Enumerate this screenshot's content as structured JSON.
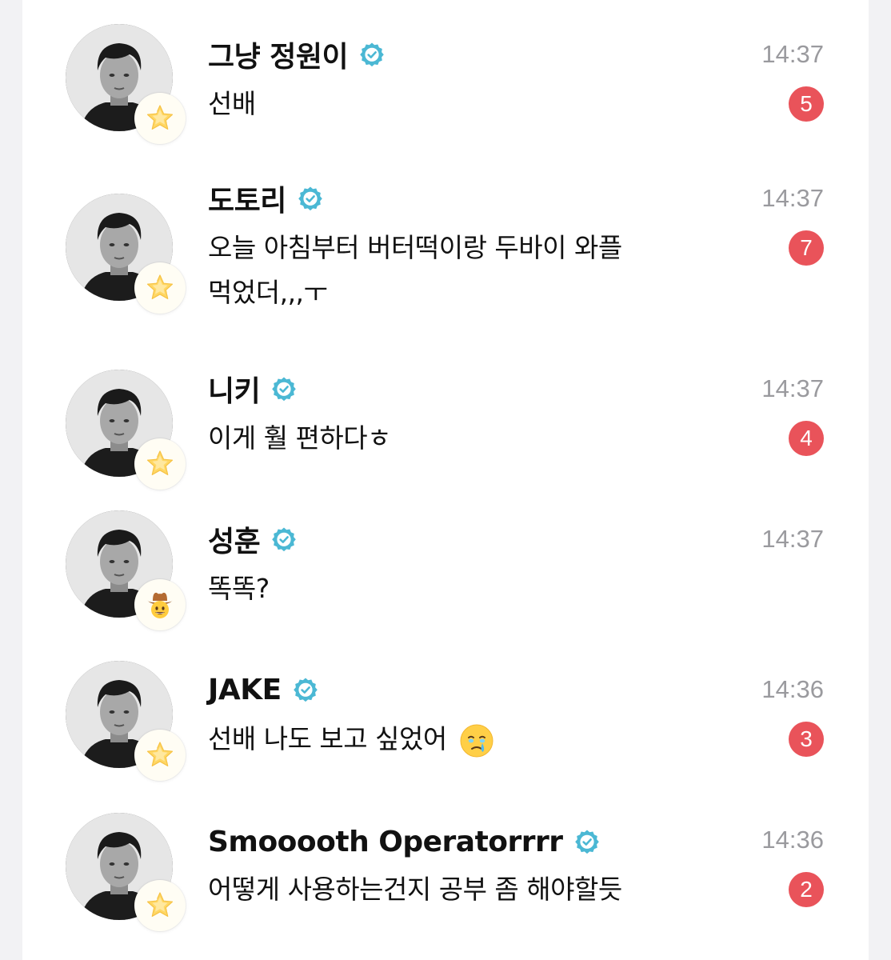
{
  "chats": [
    {
      "name": "그냥 정원이",
      "message": "선배",
      "time": "14:37",
      "unread": "5",
      "badge_icon": "star-sticker-icon"
    },
    {
      "name": "도토리",
      "message_line1": "오늘 아침부터 버터떡이랑 두바이 와플",
      "message_line2": "먹었더,,,ㅜ",
      "time": "14:37",
      "unread": "7",
      "badge_icon": "star-sticker-icon"
    },
    {
      "name": "니키",
      "message": "이게 훨 편하다ㅎ",
      "time": "14:37",
      "unread": "4",
      "badge_icon": "star-sticker-icon"
    },
    {
      "name": "성훈",
      "message": "똑똑?",
      "time": "14:37",
      "badge_icon": "cowboy-face-icon"
    },
    {
      "name": "JAKE",
      "message": "선배 나도 보고 싶었어",
      "message_emoji": "holding-back-tears-emoji-icon",
      "time": "14:36",
      "unread": "3",
      "badge_icon": "star-sticker-icon"
    },
    {
      "name": "Smooooth Operatorrrr",
      "message": "어떻게 사용하는건지 공부 좀 해야할듯",
      "time": "14:36",
      "unread": "2",
      "badge_icon": "star-sticker-icon"
    }
  ],
  "colors": {
    "unread_badge": "#e9535a",
    "verified": "#4bb8d4",
    "time_text": "#9a9a9e"
  }
}
